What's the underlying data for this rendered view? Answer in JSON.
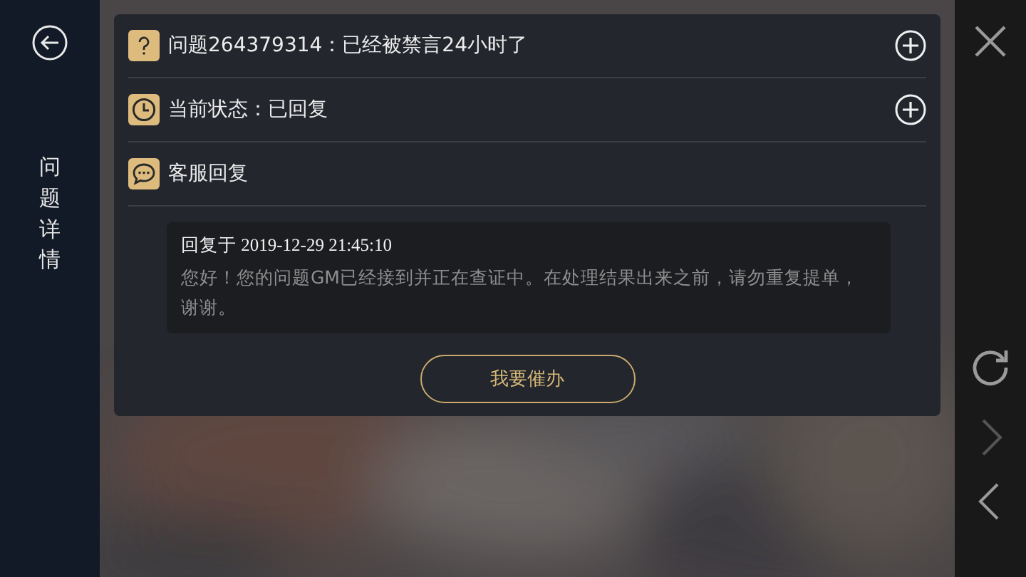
{
  "sidebar": {
    "title": "问题详情"
  },
  "rows": [
    {
      "kind": "question",
      "text": "问题264379314：已经被禁言24小时了",
      "expandable": true
    },
    {
      "kind": "status",
      "text": "当前状态：已回复",
      "expandable": true
    },
    {
      "kind": "reply",
      "text": "客服回复",
      "expandable": false
    }
  ],
  "reply": {
    "header": "回复于 2019-12-29 21:45:10",
    "body": "您好！您的问题GM已经接到并正在查证中。在处理结果出来之前，请勿重复提单，谢谢。"
  },
  "action_button": "我要催办",
  "nav": [
    {
      "kind": "close",
      "disabled": false
    },
    {
      "kind": "refresh",
      "disabled": false
    },
    {
      "kind": "forward",
      "disabled": true
    },
    {
      "kind": "back",
      "disabled": false
    }
  ]
}
